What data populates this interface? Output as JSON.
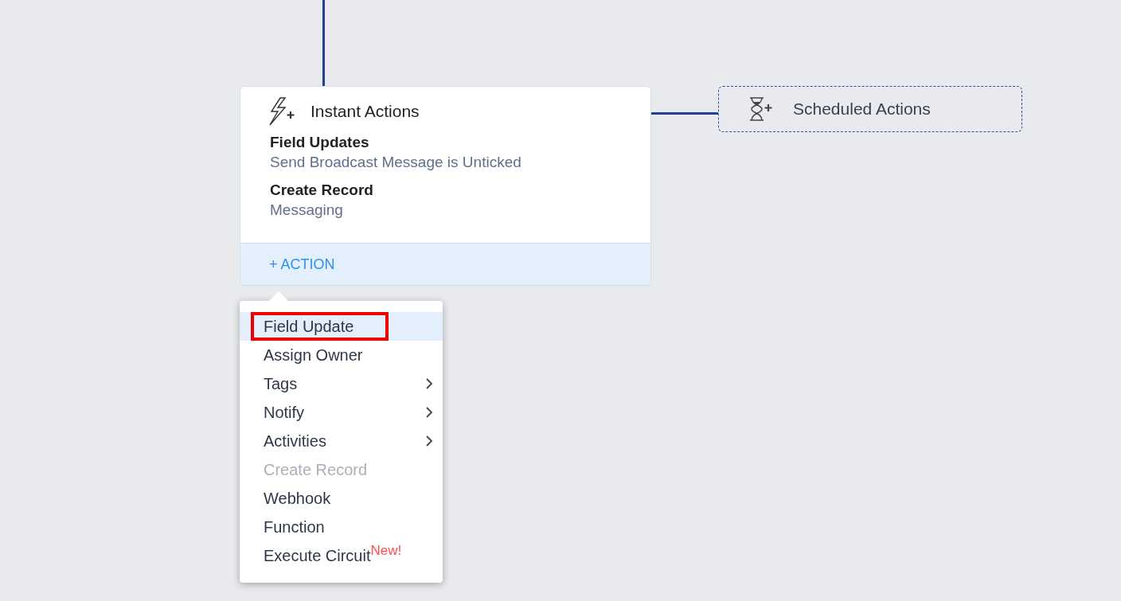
{
  "instant_actions": {
    "title": "Instant Actions",
    "entries": [
      {
        "heading": "Field Updates",
        "detail": "Send Broadcast Message is Unticked"
      },
      {
        "heading": "Create Record",
        "detail": "Messaging"
      }
    ],
    "add_button": "+ ACTION"
  },
  "scheduled_actions": {
    "title": "Scheduled Actions"
  },
  "action_menu": {
    "items": [
      {
        "label": "Field Update",
        "selected": true,
        "annotated": true,
        "disabled": false,
        "submenu": false
      },
      {
        "label": "Assign Owner",
        "selected": false,
        "annotated": false,
        "disabled": false,
        "submenu": false
      },
      {
        "label": "Tags",
        "selected": false,
        "annotated": false,
        "disabled": false,
        "submenu": true
      },
      {
        "label": "Notify",
        "selected": false,
        "annotated": false,
        "disabled": false,
        "submenu": true
      },
      {
        "label": "Activities",
        "selected": false,
        "annotated": false,
        "disabled": false,
        "submenu": true
      },
      {
        "label": "Create Record",
        "selected": false,
        "annotated": false,
        "disabled": true,
        "submenu": false
      },
      {
        "label": "Webhook",
        "selected": false,
        "annotated": false,
        "disabled": false,
        "submenu": false
      },
      {
        "label": "Function",
        "selected": false,
        "annotated": false,
        "disabled": false,
        "submenu": false
      },
      {
        "label": "Execute Circuit",
        "badge": "New!",
        "selected": false,
        "annotated": false,
        "disabled": false,
        "submenu": false
      }
    ]
  }
}
